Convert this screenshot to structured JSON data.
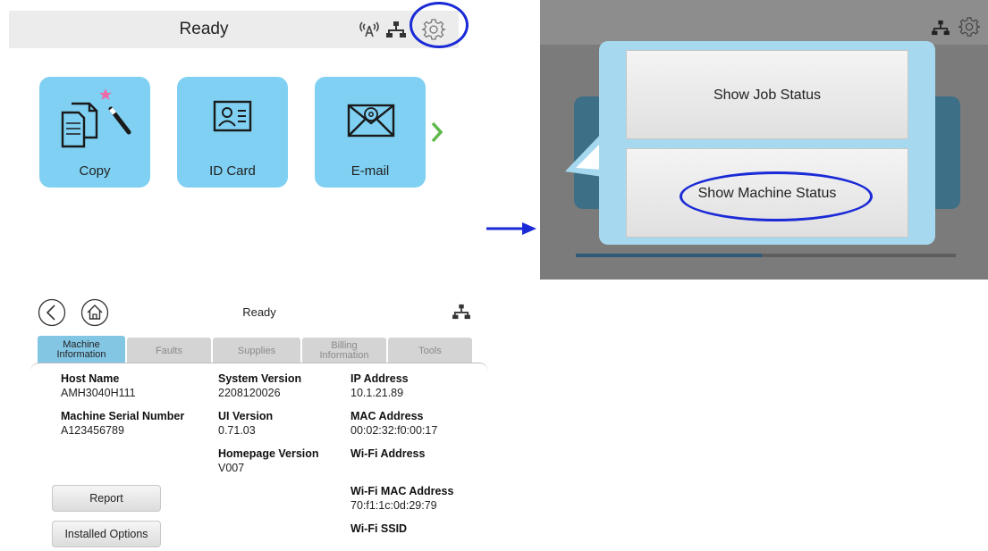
{
  "home_screen": {
    "title": "Ready",
    "tiles": [
      {
        "label": "Copy",
        "icon": "copy-icon"
      },
      {
        "label": "ID Card",
        "icon": "id-card-icon"
      },
      {
        "label": "E-mail",
        "icon": "email-icon"
      }
    ],
    "status_icons": [
      "wifi-icon",
      "network-icon",
      "gear-icon"
    ],
    "next_icon": "chevron-right-icon"
  },
  "status_popup": {
    "items": [
      "Show Job Status",
      "Show Machine Status"
    ],
    "status_icons": [
      "network-icon",
      "gear-icon"
    ],
    "progress": 0.49
  },
  "machine_status": {
    "title": "Ready",
    "tabs": [
      "Machine Information",
      "Faults",
      "Supplies",
      "Billing Information",
      "Tools"
    ],
    "active_tab": "Machine Information",
    "fields": {
      "host_name": {
        "label": "Host Name",
        "value": "AMH3040H111"
      },
      "serial_number": {
        "label": "Machine Serial Number",
        "value": "A123456789"
      },
      "system_version": {
        "label": "System Version",
        "value": "2208120026"
      },
      "ui_version": {
        "label": "UI Version",
        "value": "0.71.03"
      },
      "homepage_version": {
        "label": "Homepage Version",
        "value": "V007"
      },
      "ip_address": {
        "label": "IP Address",
        "value": "10.1.21.89"
      },
      "mac_address": {
        "label": "MAC Address",
        "value": "00:02:32:f0:00:17"
      },
      "wifi_address": {
        "label": "Wi-Fi Address",
        "value": ""
      },
      "wifi_mac_address": {
        "label": "Wi-Fi MAC Address",
        "value": "70:f1:1c:0d:29:79"
      },
      "wifi_ssid": {
        "label": "Wi-Fi SSID",
        "value": ""
      }
    },
    "buttons": {
      "report": "Report",
      "installed_options": "Installed Options"
    }
  },
  "colors": {
    "tile": "#7fd0f2",
    "highlight": "#1a2ad6",
    "active_tab": "#83c6e4",
    "chevron": "#5fb84a"
  }
}
